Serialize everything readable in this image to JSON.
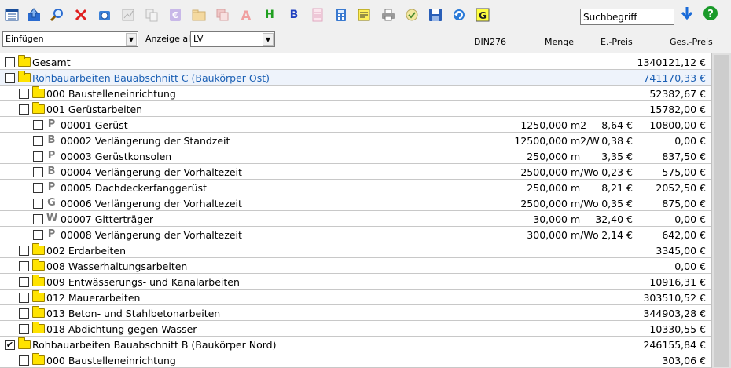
{
  "toolbar": {
    "search_placeholder": "Suchbegriff",
    "icons": [
      "list-icon",
      "upload-icon",
      "search-icon",
      "delete-icon",
      "camera-icon",
      "chart-icon",
      "copy-icon",
      "euro-icon",
      "folder-table-icon",
      "copy-table-icon",
      "text-a-icon",
      "heading-h-icon",
      "bold-b-icon",
      "document-icon",
      "calculator-icon",
      "note-icon",
      "printer-icon",
      "check-circle-icon",
      "save-icon",
      "refresh-icon",
      "g-icon",
      "download-arrow-icon",
      "help-icon"
    ]
  },
  "filterbar": {
    "mode_value": "Einfügen",
    "view_label": "Anzeige als",
    "view_value": "LV"
  },
  "columns": {
    "din": "DIN276",
    "qty": "Menge",
    "unit_price": "E.-Preis",
    "total": "Ges.-Preis"
  },
  "rows": [
    {
      "level": 0,
      "type": "folder",
      "checked": false,
      "label": "Gesamt",
      "total": "1340121,12 €"
    },
    {
      "level": 0,
      "type": "folder",
      "checked": false,
      "highlight": true,
      "label": "Rohbauarbeiten Bauabschnitt C (Baukörper Ost)",
      "total": "741170,33 €"
    },
    {
      "level": 1,
      "type": "folder",
      "checked": false,
      "label": "000 Baustelleneinrichtung",
      "total": "52382,67 €"
    },
    {
      "level": 1,
      "type": "folder",
      "checked": false,
      "label": "001 Gerüstarbeiten",
      "total": "15782,00 €"
    },
    {
      "level": 2,
      "type": "pos",
      "icon": "P",
      "checked": false,
      "label": "00001 Gerüst",
      "qty": "1250,000",
      "unit": "m2",
      "ep": "8,64 €",
      "total": "10800,00 €"
    },
    {
      "level": 2,
      "type": "pos",
      "icon": "B",
      "checked": false,
      "label": "00002 Verlängerung der Standzeit",
      "qty": "12500,000",
      "unit": "m2/W",
      "ep": "0,38 €",
      "total": "0,00 €"
    },
    {
      "level": 2,
      "type": "pos",
      "icon": "P",
      "checked": false,
      "label": "00003 Gerüstkonsolen",
      "qty": "250,000",
      "unit": "m",
      "ep": "3,35 €",
      "total": "837,50 €"
    },
    {
      "level": 2,
      "type": "pos",
      "icon": "B",
      "checked": false,
      "label": "00004 Verlängerung der Vorhaltezeit",
      "qty": "2500,000",
      "unit": "m/Wo",
      "ep": "0,23 €",
      "total": "575,00 €"
    },
    {
      "level": 2,
      "type": "pos",
      "icon": "P",
      "checked": false,
      "label": "00005 Dachdeckerfanggerüst",
      "qty": "250,000",
      "unit": "m",
      "ep": "8,21 €",
      "total": "2052,50 €"
    },
    {
      "level": 2,
      "type": "pos",
      "icon": "G",
      "checked": false,
      "label": "00006 Verlängerung der Vorhaltezeit",
      "qty": "2500,000",
      "unit": "m/Wo",
      "ep": "0,35 €",
      "total": "875,00 €"
    },
    {
      "level": 2,
      "type": "pos",
      "icon": "W",
      "checked": false,
      "label": "00007 Gitterträger",
      "qty": "30,000",
      "unit": "m",
      "ep": "32,40 €",
      "total": "0,00 €"
    },
    {
      "level": 2,
      "type": "pos",
      "icon": "P",
      "checked": false,
      "label": "00008 Verlängerung der Vorhaltezeit",
      "qty": "300,000",
      "unit": "m/Wo",
      "ep": "2,14 €",
      "total": "642,00 €"
    },
    {
      "level": 1,
      "type": "folder",
      "checked": false,
      "label": "002 Erdarbeiten",
      "total": "3345,00 €"
    },
    {
      "level": 1,
      "type": "folder",
      "checked": false,
      "label": "008 Wasserhaltungsarbeiten",
      "total": "0,00 €"
    },
    {
      "level": 1,
      "type": "folder",
      "checked": false,
      "label": "009 Entwässerungs- und Kanalarbeiten",
      "total": "10916,31 €"
    },
    {
      "level": 1,
      "type": "folder",
      "checked": false,
      "label": "012 Mauerarbeiten",
      "total": "303510,52 €"
    },
    {
      "level": 1,
      "type": "folder",
      "checked": false,
      "label": "013 Beton- und Stahlbetonarbeiten",
      "total": "344903,28 €"
    },
    {
      "level": 1,
      "type": "folder",
      "checked": false,
      "label": "018 Abdichtung gegen Wasser",
      "total": "10330,55 €"
    },
    {
      "level": 0,
      "type": "folder",
      "checked": true,
      "label": "Rohbauarbeiten Bauabschnitt B (Baukörper Nord)",
      "total": "246155,84 €"
    },
    {
      "level": 1,
      "type": "folder",
      "checked": false,
      "label": "000 Baustelleneinrichtung",
      "total": "303,06 €"
    }
  ],
  "colors": {
    "accent": "#1a5fb4",
    "folder": "#ffe300",
    "grid": "#c8c8c8"
  }
}
